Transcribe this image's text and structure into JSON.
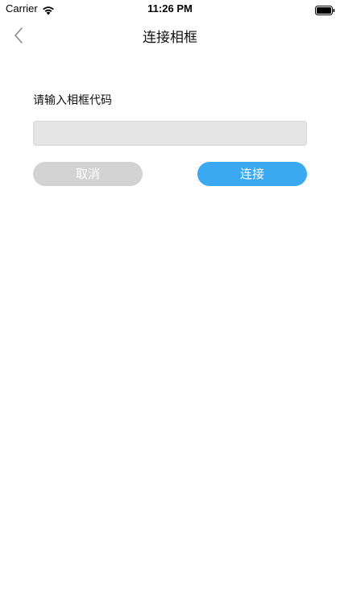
{
  "status_bar": {
    "carrier": "Carrier",
    "time": "11:26 PM",
    "icons": [
      "wifi-icon",
      "battery-icon"
    ]
  },
  "nav": {
    "title": "连接相框",
    "back_icon": "chevron-left-icon"
  },
  "form": {
    "prompt": "请输入相框代码",
    "input_value": "",
    "input_placeholder": ""
  },
  "buttons": {
    "cancel": "取消",
    "connect": "连接"
  },
  "colors": {
    "connect_button": "#3aa9f1",
    "cancel_button": "#d3d3d3",
    "input_background": "#e5e5e5"
  }
}
